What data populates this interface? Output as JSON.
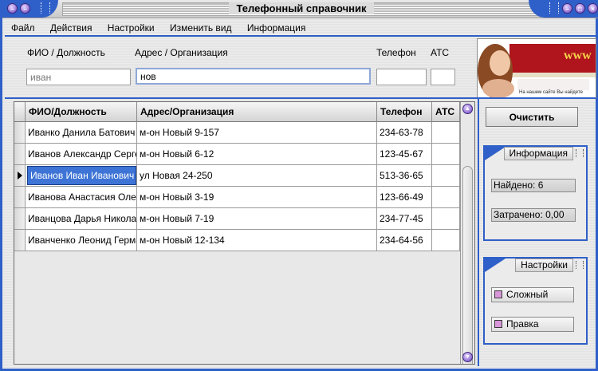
{
  "window": {
    "title": "Телефонный справочник"
  },
  "menu": [
    "Файл",
    "Действия",
    "Настройки",
    "Изменить вид",
    "Информация"
  ],
  "search": {
    "labels": {
      "fio": "ФИО / Должность",
      "address": "Адрес / Организация",
      "phone": "Телефон",
      "ats": "АТС"
    },
    "values": {
      "fio": "иван",
      "address": "нов",
      "phone": "",
      "ats": ""
    }
  },
  "banner": {
    "text": "www",
    "caption": "На нашем сайте Вы найдете"
  },
  "table": {
    "columns": [
      "ФИО/Должность",
      "Адрес/Организация",
      "Телефон",
      "АТС"
    ],
    "rows": [
      {
        "name": "Иванко Данила Батович",
        "address": "м-он Новый 9-157",
        "phone": "234-63-78",
        "ats": ""
      },
      {
        "name": "Иванов Александр Сергеевич",
        "address": "м-он Новый 6-12",
        "phone": "123-45-67",
        "ats": ""
      },
      {
        "name": "Иванов Иван Иванович",
        "address": "ул Новая 24-250",
        "phone": "513-36-65",
        "ats": ""
      },
      {
        "name": "Иванова Анастасия Олеговна",
        "address": "м-он Новый 3-19",
        "phone": "123-66-49",
        "ats": ""
      },
      {
        "name": "Иванцова Дарья Николаевна",
        "address": "м-он Новый 7-19",
        "phone": "234-77-45",
        "ats": ""
      },
      {
        "name": "Иванченко Леонид Германович",
        "address": "м-он Новый 12-134",
        "phone": "234-64-56",
        "ats": ""
      }
    ],
    "selected_row": 2
  },
  "actions": {
    "clear": "Очистить"
  },
  "info_group": {
    "title": "Информация",
    "found": "Найдено: 6",
    "spent": "Затрачено: 0,00"
  },
  "settings_group": {
    "title": "Настройки",
    "complex": "Сложный",
    "edit": "Правка"
  },
  "colors": {
    "accent": "#2f5fc8",
    "selection": "#3d74d6",
    "checkbox": "#d897d8"
  }
}
